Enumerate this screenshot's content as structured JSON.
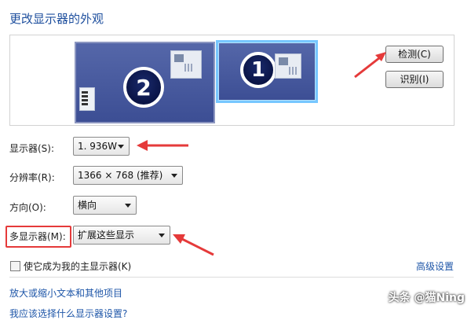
{
  "header": {
    "title": "更改显示器的外观"
  },
  "preview": {
    "monitor_2_number": "2",
    "monitor_1_number": "1",
    "detect_label": "检测(C)",
    "identify_label": "识别(I)"
  },
  "settings": {
    "display_label": "显示器(S):",
    "display_value": "1. 936W",
    "resolution_label": "分辨率(R):",
    "resolution_value": "1366 × 768 (推荐)",
    "orientation_label": "方向(O):",
    "orientation_value": "横向",
    "multi_display_label": "多显示器(M):",
    "multi_display_value": "扩展这些显示"
  },
  "checkbox": {
    "label": "使它成为我的主显示器(K)",
    "checked": false
  },
  "links": {
    "advanced": "高级设置",
    "enlarge_text": "放大或缩小文本和其他项目",
    "which_settings": "我应该选择什么显示器设置?"
  },
  "watermark": {
    "text": "头条 @猫Ning"
  },
  "colors": {
    "title_blue": "#1e4f9e",
    "link_blue": "#1e56a8",
    "annotation_red": "#e53a3a",
    "monitor_blue": "#3c4e94",
    "selected_border": "#77c7ff"
  },
  "icons": [
    "window-thumbnail-icon",
    "document-icon",
    "red-annotation-arrow"
  ]
}
